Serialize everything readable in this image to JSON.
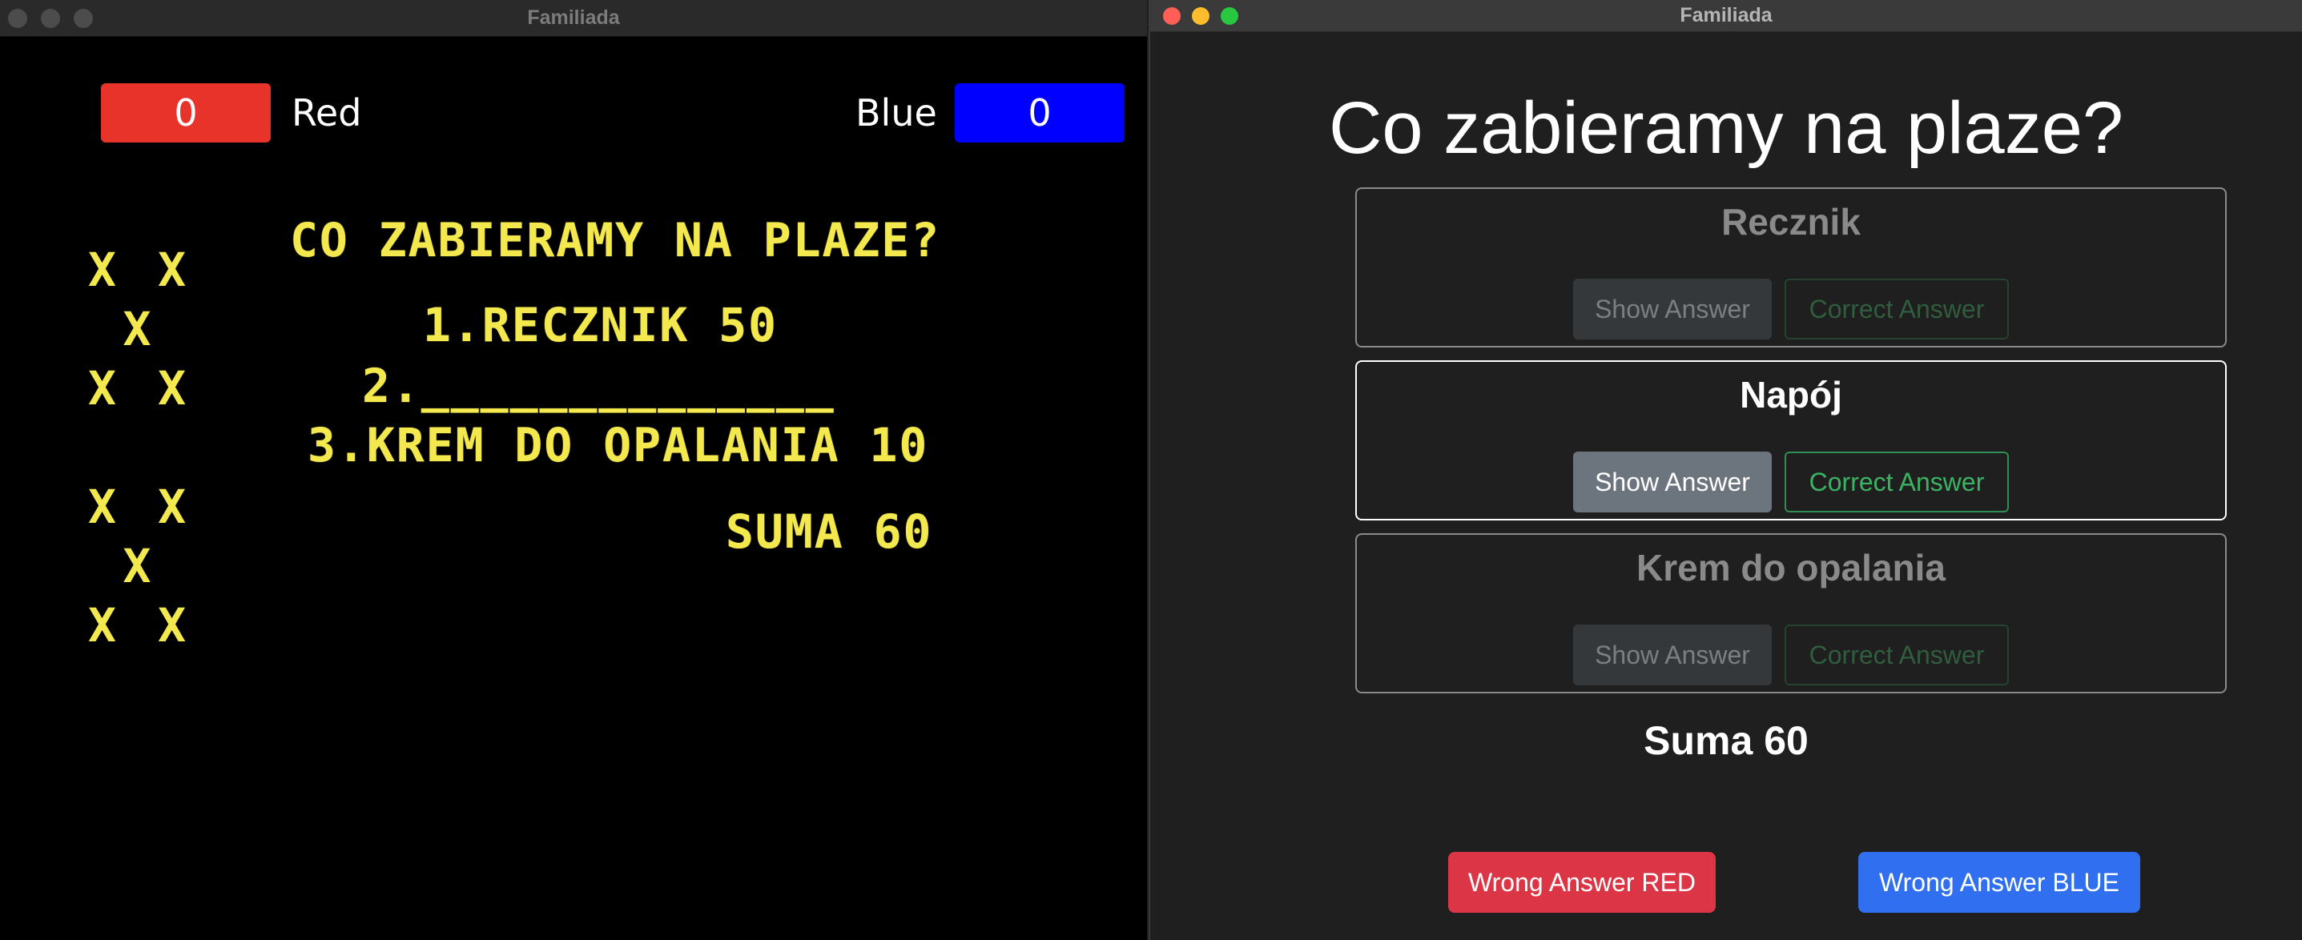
{
  "left_window": {
    "title": "Familiada",
    "scores": {
      "red": "0",
      "blue": "0"
    },
    "teams": {
      "red": "Red",
      "blue": "Blue"
    },
    "board": {
      "question": "CO ZABIERAMY NA PLAZE?",
      "rows": [
        "1.RECZNIK 50",
        "2.______________",
        "3.KREM DO OPALANIA 10"
      ],
      "sum": "SUMA 60"
    },
    "strike_glyph": "X",
    "led_color": "#f3e84e"
  },
  "right_window": {
    "title": "Familiada",
    "question": "Co zabieramy na plaze?",
    "answers": [
      {
        "name": "Recznik",
        "show_label": "Show Answer",
        "correct_label": "Correct Answer"
      },
      {
        "name": "Napój",
        "show_label": "Show Answer",
        "correct_label": "Correct Answer"
      },
      {
        "name": "Krem do opalania",
        "show_label": "Show Answer",
        "correct_label": "Correct Answer"
      }
    ],
    "sum": "Suma 60",
    "wrong_red": "Wrong Answer RED",
    "wrong_blue": "Wrong Answer BLUE"
  },
  "colors": {
    "red_team": "#e8332a",
    "blue_team": "#0000ff",
    "wrong_red_button": "#dc3545",
    "wrong_blue_button": "#2f6ff0"
  }
}
